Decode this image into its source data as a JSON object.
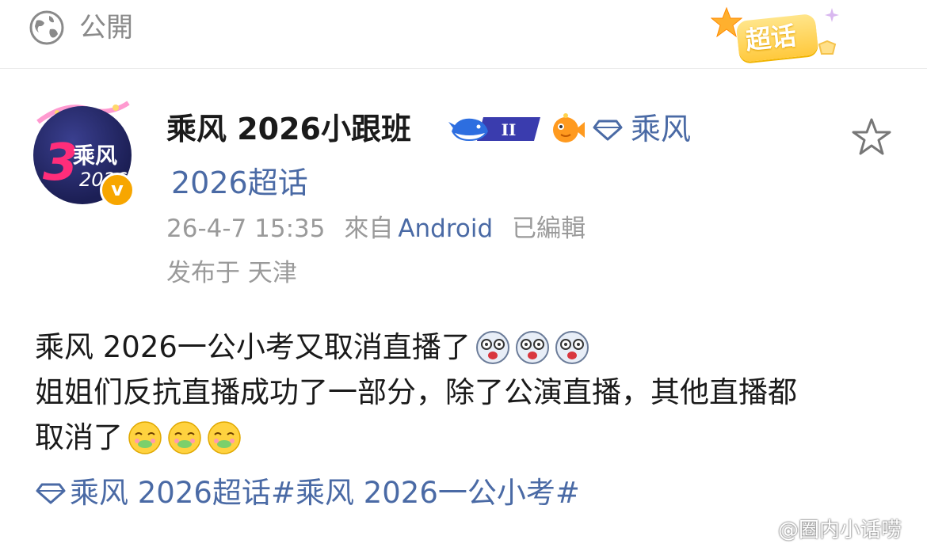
{
  "header": {
    "visibility_label": "公開",
    "supertopic_badge_label": "超话"
  },
  "post": {
    "author": {
      "name": "乘风 2026小跟班",
      "avatar_text": "乘风",
      "avatar_year": "2026",
      "avatar_number": "3",
      "verified_mark": "v",
      "level_badge": "II"
    },
    "supertopic_link": {
      "line1": "乘风",
      "line2": "2026超话"
    },
    "meta": {
      "timestamp": "26-4-7 15:35",
      "from_label": "來自",
      "source": "Android",
      "edited_label": "已編輯",
      "location": "发布于 天津"
    },
    "body_lines": [
      "乘风 2026一公小考又取消直播了",
      "姐姐们反抗直播成功了一部分，除了公演直播，其他直播都",
      "取消了"
    ],
    "hashtags": {
      "topic": "乘风 2026超话",
      "tag": "#乘风 2026一公小考#"
    }
  },
  "watermark": {
    "text": "@圈内小话唠"
  },
  "colors": {
    "link": "#4a6aa5",
    "meta_gray": "#9a9a9a",
    "badge_gold": "#ffc93d",
    "verified": "#f7a600"
  },
  "icons": [
    "globe-icon",
    "star-icon",
    "diamond-icon",
    "fish-icon",
    "whale-badge-icon",
    "weibo-icon",
    "shocked-dog-emoji",
    "crying-face-emoji"
  ]
}
